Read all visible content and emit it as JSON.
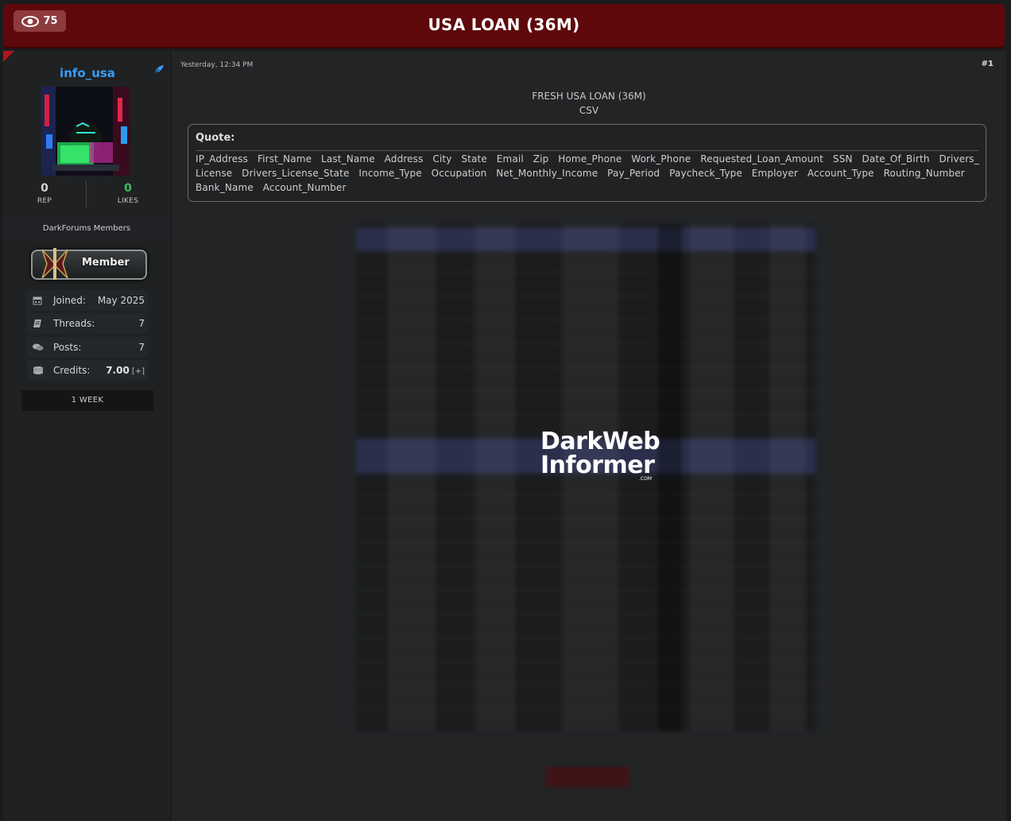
{
  "header": {
    "views": "75",
    "title": "USA LOAN (36M)"
  },
  "sidebar": {
    "username": "info_usa",
    "rep": {
      "value": "0",
      "label": "REP"
    },
    "likes": {
      "value": "0",
      "label": "LIKES"
    },
    "group": "DarkForums Members",
    "badge": "Member",
    "info": [
      {
        "label": "Joined:",
        "value": "May 2025",
        "icon": "calendar-icon"
      },
      {
        "label": "Threads:",
        "value": "7",
        "icon": "book-icon"
      },
      {
        "label": "Posts:",
        "value": "7",
        "icon": "comments-icon"
      },
      {
        "label": "Credits:",
        "value": "7.00",
        "extra": "[+]",
        "icon": "coins-icon"
      }
    ],
    "tenure": "1 WEEK"
  },
  "post": {
    "date": "Yesterday, 12:34 PM",
    "number": "#1",
    "heading": "FRESH USA LOAN (36M)",
    "subheading": "CSV",
    "quote_label": "Quote:",
    "quote_text": "IP_Address   First_Name   Last_Name   Address   City   State   Email   Zip   Home_Phone   Work_Phone   Requested_Loan_Amount   SSN   Date_Of_Birth   Drivers_License   Drivers_License_State   Income_Type   Occupation   Net_Monthly_Income   Pay_Period   Paycheck_Type   Employer   Account_Type   Routing_Number   Bank_Name   Account_Number",
    "watermark": {
      "line1": "DarkWeb",
      "line2": "Informer",
      "suffix": ".COM"
    }
  },
  "colors": {
    "header_bg": "#5f080b",
    "username": "#3a9cf5",
    "likes": "#3ec25b",
    "page_bg": "#1b1c1e"
  }
}
